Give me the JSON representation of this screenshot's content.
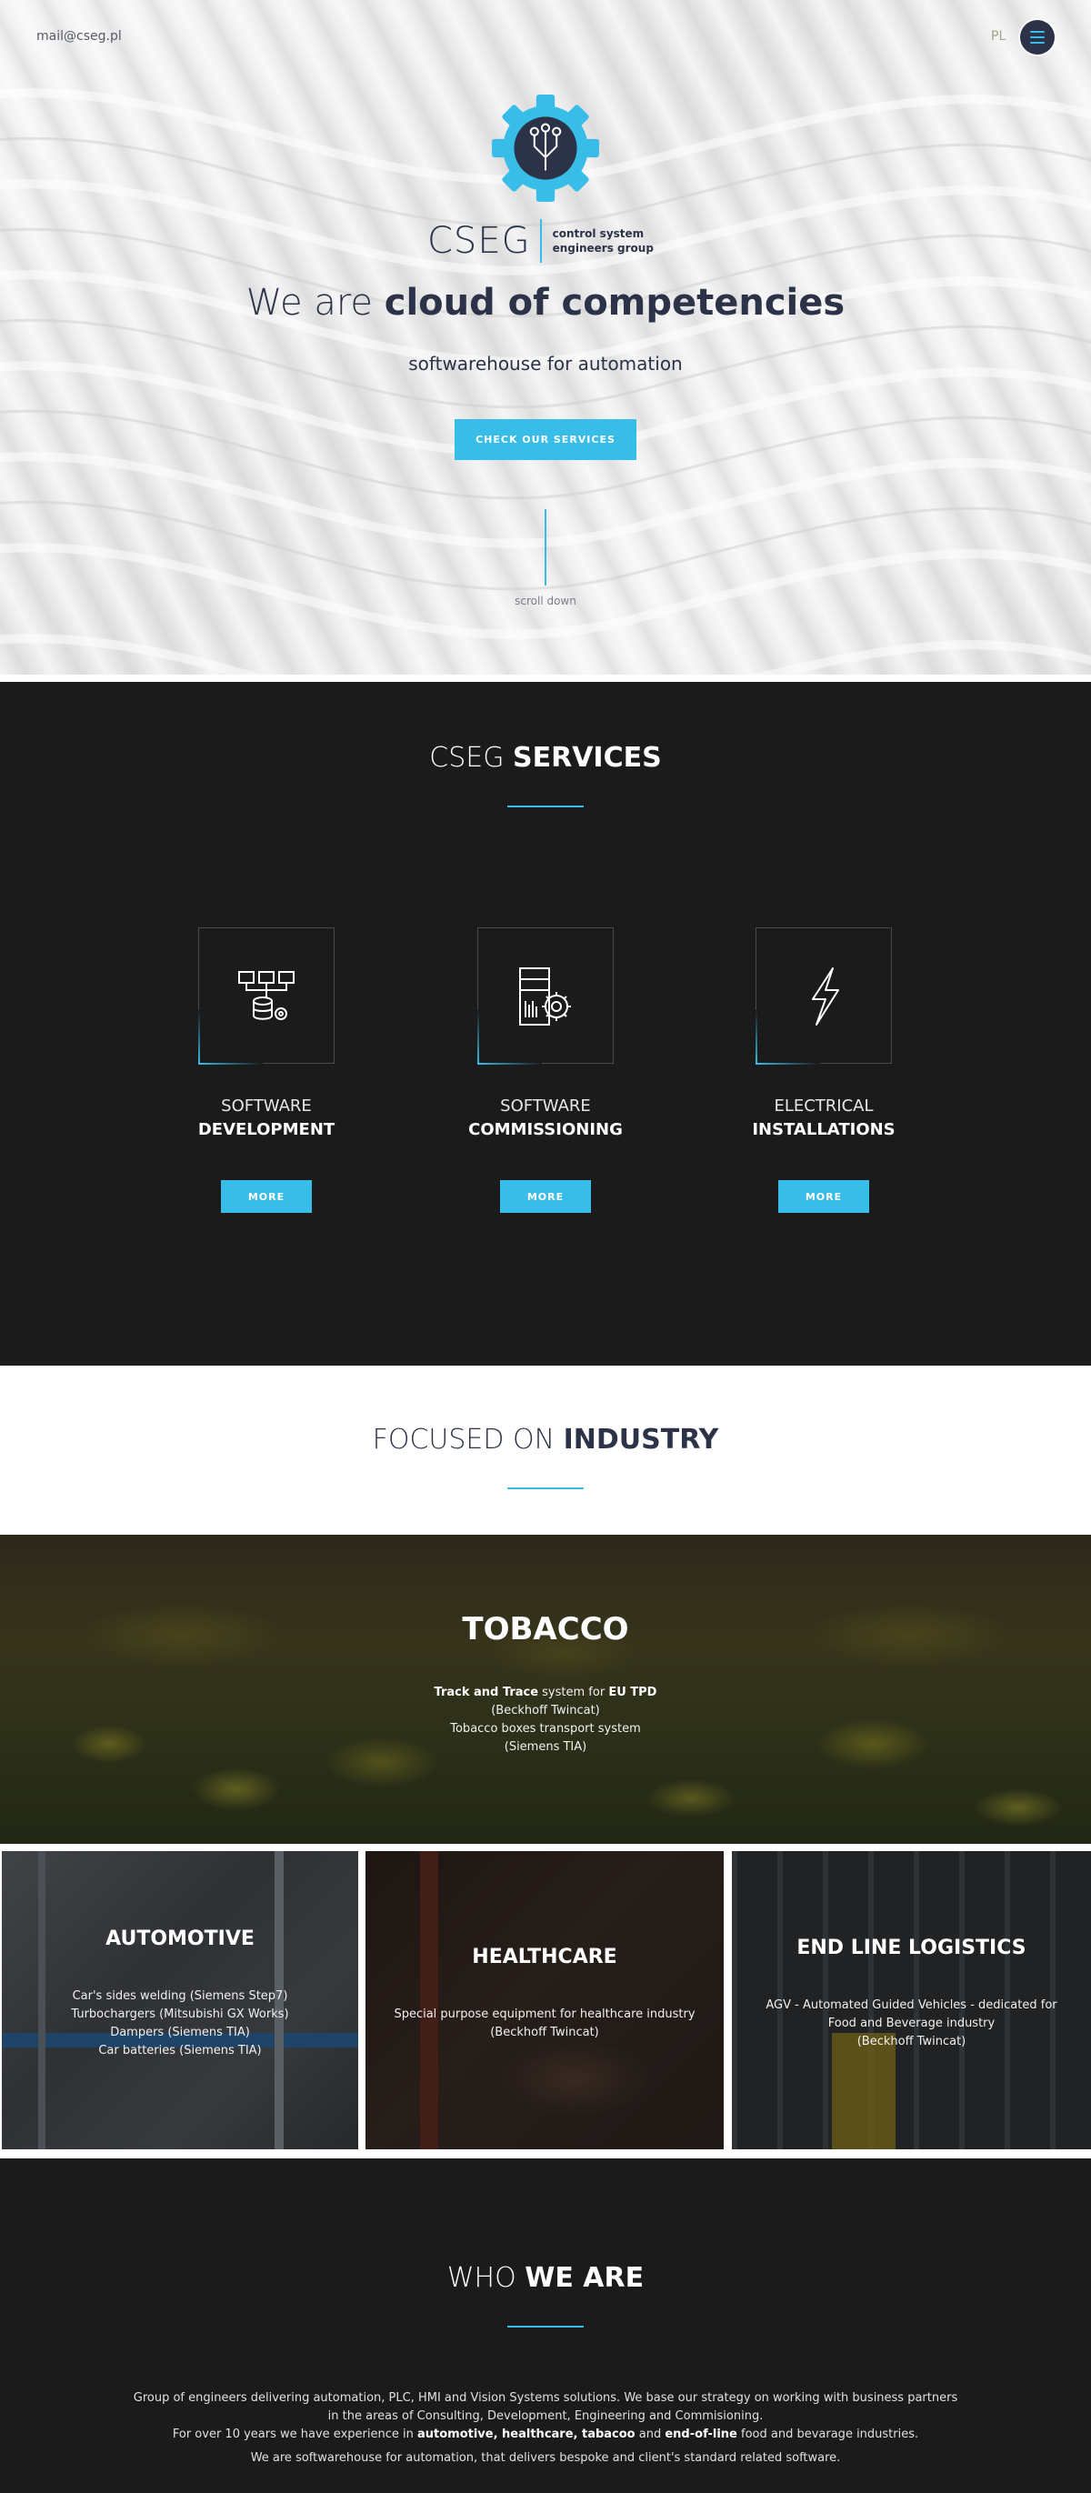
{
  "header": {
    "email": "mail@cseg.pl",
    "language": "PL",
    "menu_icon": "hamburger-icon"
  },
  "hero": {
    "brand_name": "CSEG",
    "brand_sub_line1": "control system",
    "brand_sub_line2": "engineers group",
    "title_plain": "We are ",
    "title_bold": "cloud of competencies",
    "subtitle": "softwarehouse for automation",
    "cta_label": "CHECK OUR SERVICES",
    "scroll_label": "scroll down"
  },
  "services": {
    "title_plain": "CSEG ",
    "title_bold": "SERVICES",
    "items": [
      {
        "line1": "SOFTWARE",
        "line2": "DEVELOPMENT",
        "button": "MORE",
        "icon": "network-database-icon"
      },
      {
        "line1": "SOFTWARE",
        "line2": "COMMISSIONING",
        "button": "MORE",
        "icon": "server-gear-icon"
      },
      {
        "line1": "ELECTRICAL",
        "line2": "INSTALLATIONS",
        "button": "MORE",
        "icon": "lightning-icon"
      }
    ]
  },
  "industry": {
    "title_plain": "FOCUSED ON ",
    "title_bold": "INDUSTRY",
    "tobacco": {
      "title": "TOBACCO",
      "line1_bold_a": "Track and Trace",
      "line1_plain": " system for ",
      "line1_bold_b": "EU TPD",
      "line2": "(Beckhoff Twincat)",
      "line3": "Tobacco boxes transport system",
      "line4": "(Siemens TIA)"
    },
    "automotive": {
      "title": "AUTOMOTIVE",
      "lines": [
        "Car's sides welding (Siemens Step7)",
        "Turbochargers (Mitsubishi GX Works)",
        "Dampers (Siemens TIA)",
        "Car batteries (Siemens TIA)"
      ]
    },
    "healthcare": {
      "title": "HEALTHCARE",
      "lines": [
        "Special purpose equipment for healthcare industry",
        "(Beckhoff Twincat)"
      ]
    },
    "logistics": {
      "title": "END LINE LOGISTICS",
      "lines": [
        "AGV - Automated Guided Vehicles - dedicated for",
        "Food and Beverage industry",
        "(Beckhoff Twincat)"
      ]
    }
  },
  "who": {
    "title_plain": "WHO ",
    "title_bold": "WE ARE",
    "p1_line1": "Group of engineers delivering automation, PLC, HMI and Vision Systems solutions. We base our strategy on working with business partners",
    "p1_line2": "in the areas of Consulting, Development, Engineering and Commisioning.",
    "p1_line3_a": "For over 10 years we have experience in ",
    "p1_line3_b": "automotive, healthcare, tabacoo",
    "p1_line3_c": " and ",
    "p1_line3_d": "end-of-line",
    "p1_line3_e": " food and bevarage industries.",
    "p2": "We are softwarehouse for automation, that delivers bespoke and client's standard related software."
  },
  "colors": {
    "accent": "#38bde8",
    "navy": "#2c3248",
    "dark_bg": "#1b1b1c"
  }
}
